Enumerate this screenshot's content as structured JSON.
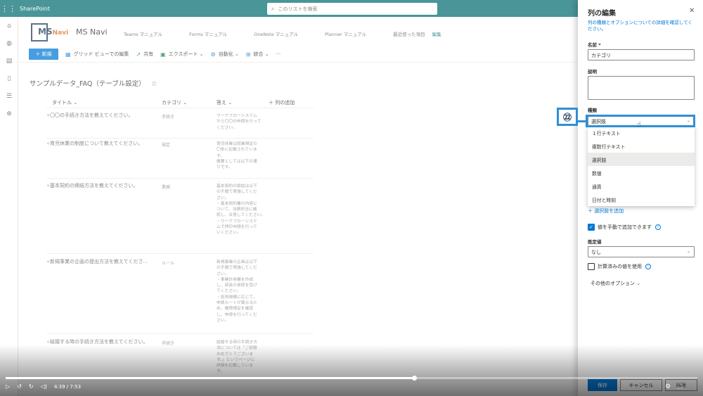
{
  "suite": {
    "app_name": "SharePoint",
    "search_placeholder": "このリストを検索"
  },
  "site": {
    "logo_text": "MS",
    "logo_sub": "Navi",
    "name": "MS Navi",
    "nav": [
      "Teams マニュアル",
      "Forms マニュアル",
      "OneNote マニュアル",
      "Planner マニュアル",
      "最近使った項目",
      "編集"
    ]
  },
  "commands": {
    "new": "＋ 新規",
    "grid_edit": "グリッド ビューでの編集",
    "share": "共有",
    "export": "エクスポート",
    "automate": "自動化",
    "integrate": "統合",
    "more": "···"
  },
  "list": {
    "title": "サンプルデータ_FAQ（テーブル設定）",
    "columns": {
      "title": "タイトル",
      "category": "カテゴリ",
      "answer": "答え",
      "add_column": "＋ 列の追加"
    },
    "rows": [
      {
        "title": "〇〇の手続き方法を教えてください。",
        "category": "手続き",
        "answer": "ワークフローシステム\nから〇〇の申請を行って\nください。"
      },
      {
        "title": "育児休業の制度について教えてください。",
        "category": "規定",
        "answer": "育児休業は就業規定の\n〇条に記載されていま\nす。\n概要としては以下の通\nりです。"
      },
      {
        "title": "基本契約の締結方法を教えてください。",
        "category": "業務",
        "answer": "基本契約の締結は以下\nの手順で実施してくだ\nさい。\n・基本契約書の内容に\nついて、法務担当に確\n認し、合意してください。\n・ワークフローシステ\nムで押印申請を行って\nいください。"
      },
      {
        "title": "新規事業の企画の提出方法を教えてくださ...",
        "category": "ルール",
        "answer": "新規事業の企画は以下\nの手順で実施してくだ\nさい。\n・事業計画書を作成\nし、部長の承認を受け\nてください。\n・投資規模に応じて、\n申請ルートが異なるた\nめ、権限規定を確認\nし、申請を行ってくだ\nさい。"
      },
      {
        "title": "結婚する時の手続き方法を教えてください。",
        "category": "手続き",
        "answer": "結婚する時の手続き方\n法については「ご結婚\nおめでとうございま\nす。」というページに\n詳細を記載していま\nす。"
      }
    ]
  },
  "panel": {
    "title": "列の編集",
    "close": "✕",
    "description": "列の種類とオプションについての詳細を確認してください。",
    "name_label": "名前 *",
    "name_value": "カテゴリ",
    "desc_label": "説明",
    "desc_value": "",
    "type_label": "種類",
    "type_value": "選択肢",
    "type_options": [
      "１行テキスト",
      "複数行テキスト",
      "選択肢",
      "数値",
      "通貨",
      "日付と時刻"
    ],
    "add_choice": "＋ 選択肢を追加",
    "manual_values_label": "値を手動で追加できます",
    "default_label": "既定値",
    "default_value": "なし",
    "calc_label": "計算済みの値を使用",
    "more_options": "その他のオプション",
    "save": "保存",
    "cancel": "キャンセル",
    "delete": "削除"
  },
  "callout": {
    "number": "㉒"
  },
  "player": {
    "time": "4:39 / 7:53",
    "progress": 0.59
  }
}
